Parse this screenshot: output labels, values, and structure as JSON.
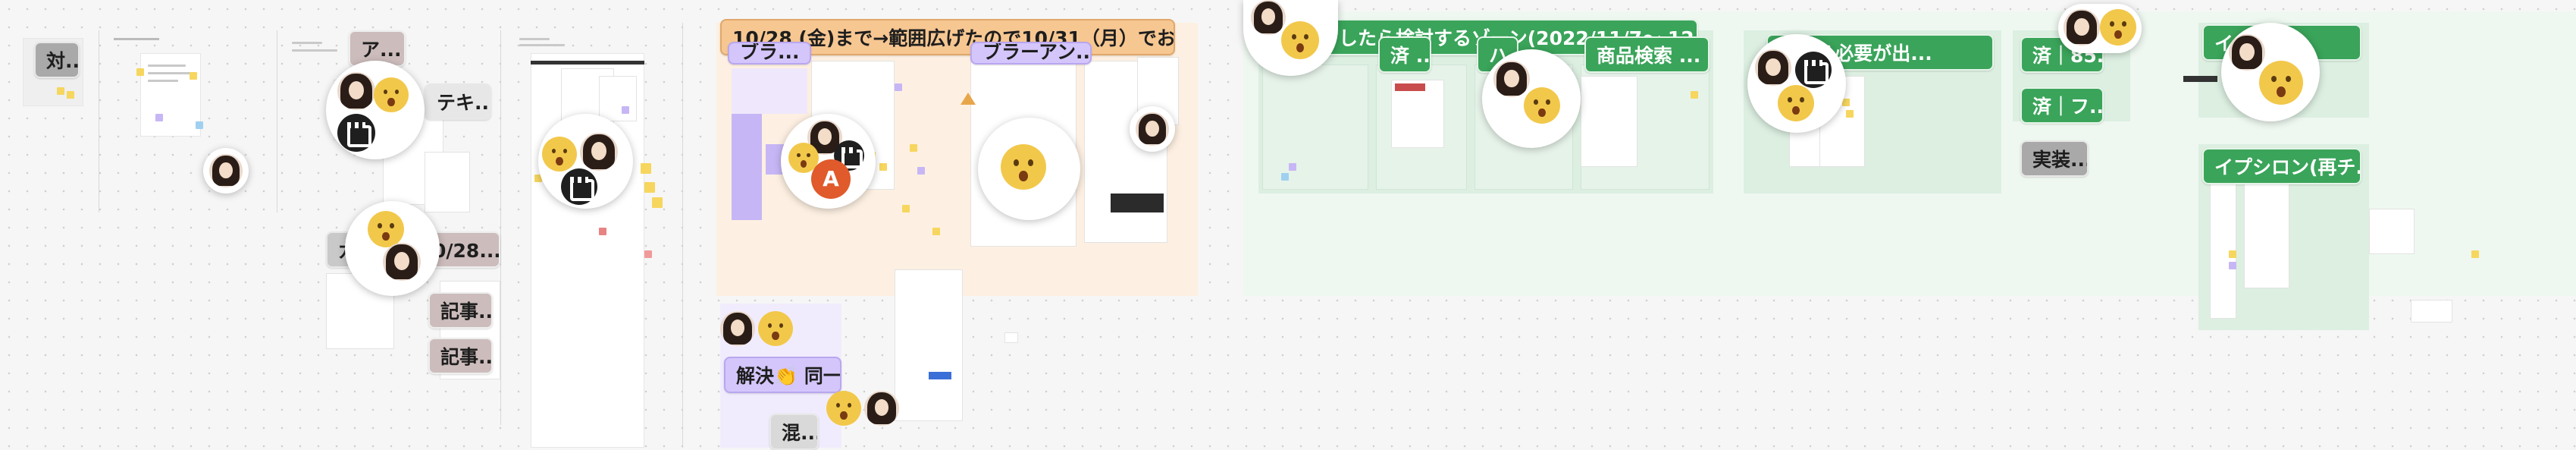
{
  "board": {
    "tags": {
      "t1": "対...",
      "t2": "ア...",
      "t3": "テキ...",
      "t4": "ガ...",
      "t5": "0/28...",
      "t6": "記事...",
      "t7": "記事...",
      "t8": "10/28 (金)まで→範囲広げたので10/31（月）でお願いし...",
      "t9": "ブラ...",
      "t10": "ブラーアン...",
      "t11": "解決👏 同一...",
      "t12": "混...",
      "t13": "完了したら検討するゾーン(2022/11/7〜 12/2)",
      "t14": "済 ...",
      "t15": "ハ...",
      "t16": "商品検索 ...",
      "t17": "変える必要が出...",
      "t18": "済｜85...",
      "t19": "済｜フ...",
      "t20": "実装...",
      "t21": "イ...2/8...",
      "t22": "イプシロン(再チ..."
    }
  },
  "colors": {
    "green_section": "#dcefe1",
    "green_light": "#eef8f0",
    "orange_section": "#fdf0e2",
    "purple_sticky": "#c7b6f5",
    "yellow_sticky": "#f6d65e"
  },
  "icons": [
    "shocked-face-icon",
    "user-avatar-icon",
    "clapper-board-icon",
    "letter-a-avatar-icon"
  ]
}
